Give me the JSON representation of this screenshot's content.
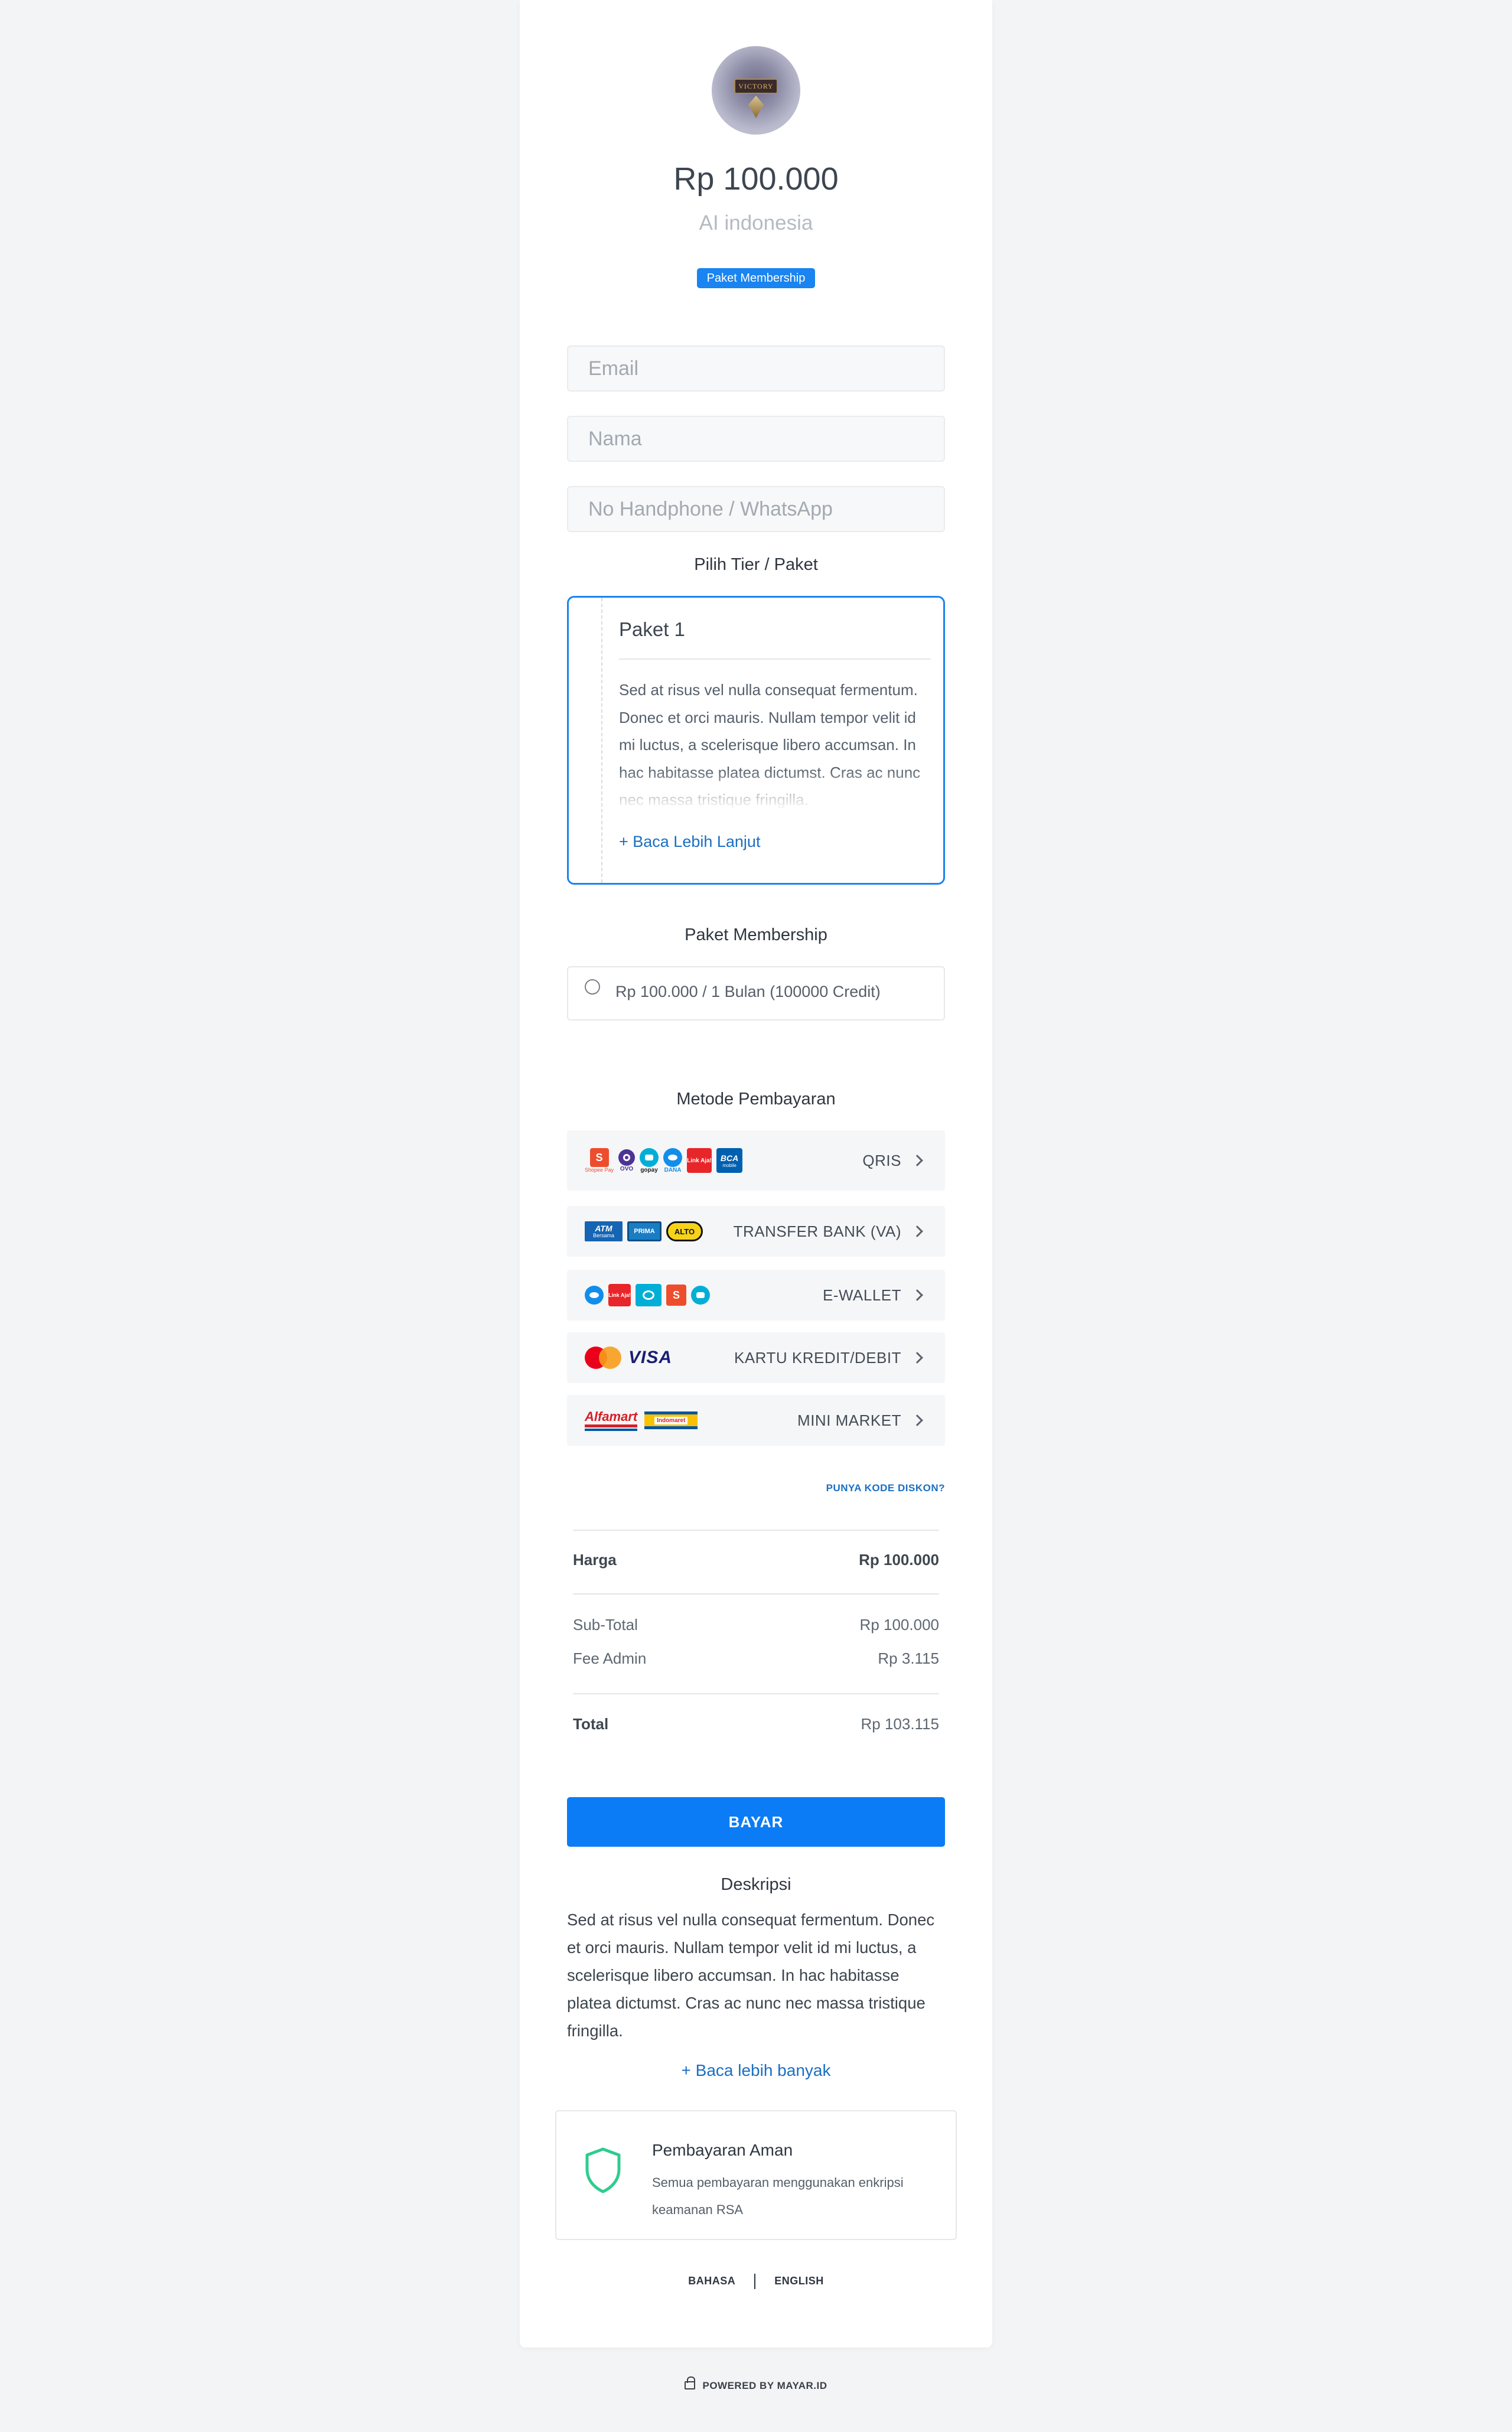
{
  "product": {
    "avatar_text": "VICTORY",
    "price": "Rp 100.000",
    "store_name": "AI indonesia",
    "badge": "Paket Membership"
  },
  "form": {
    "email_placeholder": "Email",
    "name_placeholder": "Nama",
    "phone_placeholder": "No Handphone / WhatsApp"
  },
  "tier": {
    "section_title": "Pilih Tier / Paket",
    "name": "Paket 1",
    "description": "Sed at risus vel nulla consequat fermentum. Donec et orci mauris. Nullam tempor velit id mi luctus, a scelerisque libero accumsan. In hac habitasse platea dictumst. Cras ac nunc nec massa tristique fringilla.",
    "read_more": "+ Baca Lebih Lanjut"
  },
  "membership": {
    "section_title": "Paket Membership",
    "option_label": "Rp 100.000 / 1 Bulan (100000 Credit)"
  },
  "payment": {
    "section_title": "Metode Pembayaran",
    "methods": [
      {
        "label": "QRIS"
      },
      {
        "label": "TRANSFER BANK (VA)"
      },
      {
        "label": "E-WALLET"
      },
      {
        "label": "KARTU KREDIT/DEBIT"
      },
      {
        "label": "MINI MARKET"
      }
    ],
    "logo_text": {
      "shopee": "S",
      "shopeepay_caption": "Shopee Pay",
      "ovo": "OVO",
      "gopay": "gopay",
      "dana": "DANA",
      "linkaja": "Link Aja!",
      "bca": "BCA",
      "bca_caption": "mobile",
      "atm": "ATM",
      "atm_caption": "Bersama",
      "prima": "PRIMA",
      "alto": "ALTO",
      "visa": "VISA",
      "alfamart": "Alfamart",
      "indomaret": "Indomaret"
    },
    "brand_colors": {
      "shopee": "#ee4d2d",
      "ovo": "#4c3494",
      "gopay": "#00aed6",
      "dana": "#118eea",
      "linkaja": "#e82529",
      "bca": "#0060af",
      "mastercard_red": "#eb001b",
      "mastercard_yellow": "#f79e1b",
      "visa": "#1a1f71",
      "alfamart": "#d71f26"
    }
  },
  "discount_link": "PUNYA KODE DISKON?",
  "summary": {
    "harga_label": "Harga",
    "harga_value": "Rp 100.000",
    "subtotal_label": "Sub-Total",
    "subtotal_value": "Rp 100.000",
    "fee_label": "Fee Admin",
    "fee_value": "Rp 3.115",
    "total_label": "Total",
    "total_value": "Rp 103.115"
  },
  "pay_button": "BAYAR",
  "description": {
    "title": "Deskripsi",
    "text": "Sed at risus vel nulla consequat fermentum. Donec et orci mauris. Nullam tempor velit id mi luctus, a scelerisque libero accumsan. In hac habitasse platea dictumst. Cras ac nunc nec massa tristique fringilla.",
    "read_more": "+ Baca lebih banyak"
  },
  "secure": {
    "title": "Pembayaran Aman",
    "text": "Semua pembayaran menggunakan enkripsi keamanan RSA",
    "icon": "shield-icon",
    "icon_color": "#2ecc8f"
  },
  "language": {
    "bahasa": "BAHASA",
    "english": "ENGLISH"
  },
  "footer": {
    "powered_by": "POWERED BY MAYAR.ID"
  },
  "colors": {
    "accent": "#0b7cf5",
    "link": "#1a6fc2",
    "background": "#f2f4f6"
  }
}
